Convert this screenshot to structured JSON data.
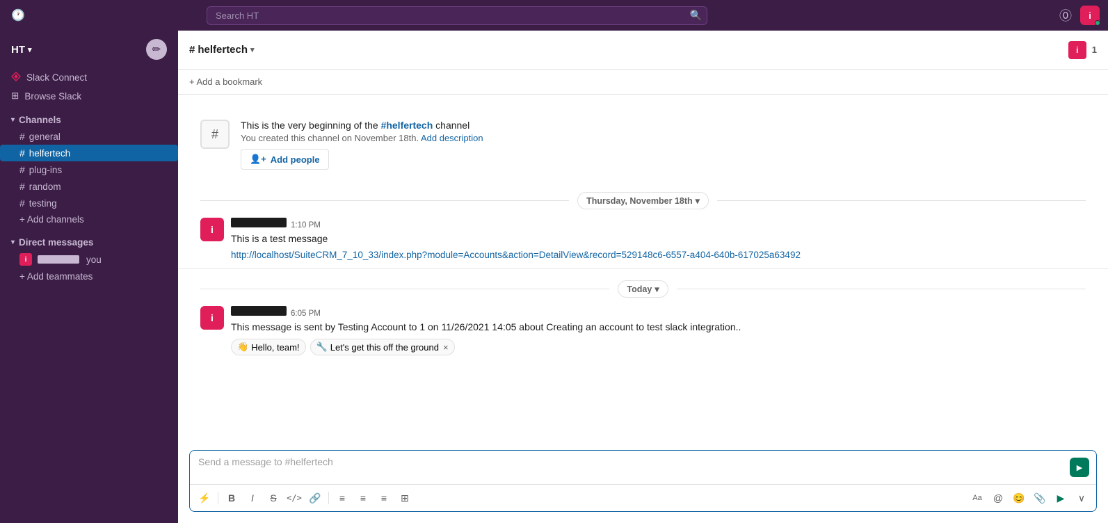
{
  "topbar": {
    "search_placeholder": "Search HT",
    "avatar_label": "i",
    "help_label": "?"
  },
  "sidebar": {
    "workspace": "HT",
    "slack_connect_label": "Slack Connect",
    "browse_slack_label": "Browse Slack",
    "channels_header": "Channels",
    "channels": [
      {
        "name": "general",
        "active": false
      },
      {
        "name": "helfertech",
        "active": true
      },
      {
        "name": "plug-ins",
        "active": false
      },
      {
        "name": "random",
        "active": false
      },
      {
        "name": "testing",
        "active": false
      }
    ],
    "add_channels_label": "+ Add channels",
    "direct_messages_header": "Direct messages",
    "dm_items": [
      {
        "label": "you",
        "avatar": "i"
      }
    ],
    "add_teammates_label": "+ Add teammates"
  },
  "channel": {
    "name": "# helfertech",
    "name_hash": "#",
    "name_text": "helfertech",
    "member_count": "1",
    "avatar_label": "i",
    "bookmark_label": "+ Add a bookmark",
    "intro": {
      "icon": "#",
      "title_prefix": "This is the very beginning of the ",
      "title_channel": "#helfertech",
      "title_suffix": " channel",
      "subtitle": "You created this channel on November 18th.",
      "add_description_label": "Add description"
    },
    "add_people_label": "Add people"
  },
  "dividers": {
    "thursday": "Thursday, November 18th",
    "thursday_chevron": "▾",
    "today": "Today",
    "today_chevron": "▾"
  },
  "messages": [
    {
      "id": "msg1",
      "author_redacted": true,
      "time": "1:10 PM",
      "text": "This is a test message",
      "link": "http://localhost/SuiteCRM_7_10_33/index.php?module=Accounts&action=DetailView&record=529148c6-6557-a404-640b-617025a63492"
    },
    {
      "id": "msg2",
      "author_redacted": true,
      "time": "6:05 PM",
      "text": "This message is sent by Testing Account to 1 on  11/26/2021 14:05 about  Creating an account to test slack integration..",
      "link": null,
      "reactions": [
        {
          "emoji": "👋",
          "label": "Hello, team!"
        },
        {
          "emoji": "🔧",
          "label": "Let's get this off the ground"
        }
      ]
    }
  ],
  "message_input": {
    "placeholder": "Send a message to #helfertech",
    "send_icon": "▶",
    "toolbar_items": [
      "⚡",
      "B",
      "I",
      "S",
      "</>",
      "🔗",
      "≡",
      "≡",
      "≡",
      "⊞"
    ],
    "toolbar_right_items": [
      "Aa",
      "@",
      "😊",
      "📎",
      "▶",
      "∨"
    ]
  }
}
